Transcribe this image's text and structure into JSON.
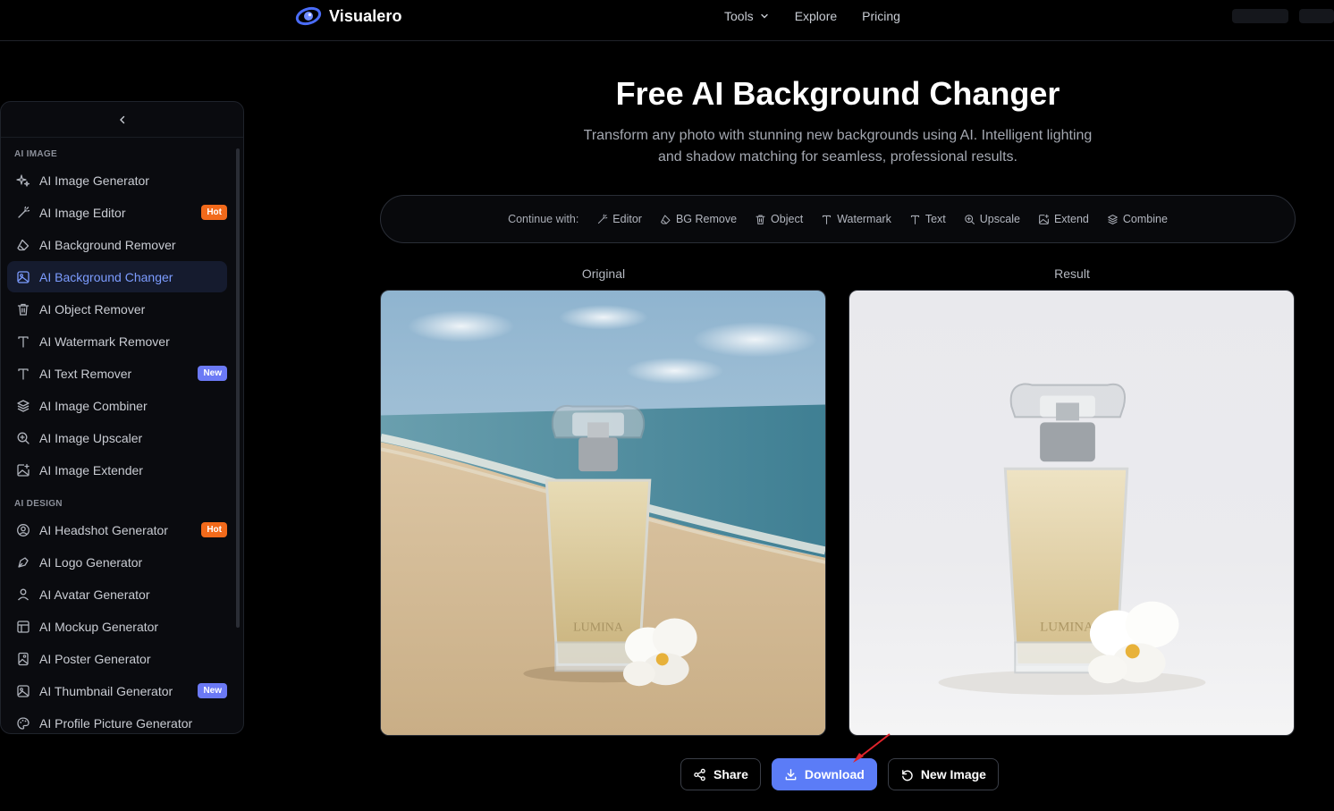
{
  "brand": {
    "name": "Visualero"
  },
  "nav": {
    "tools": "Tools",
    "explore": "Explore",
    "pricing": "Pricing"
  },
  "sidebar": {
    "sections": [
      {
        "label": "AI IMAGE",
        "items": [
          {
            "label": "AI Image Generator",
            "icon": "sparkles-icon"
          },
          {
            "label": "AI Image Editor",
            "icon": "magic-wand-icon",
            "badge": "Hot"
          },
          {
            "label": "AI Background Remover",
            "icon": "eraser-icon"
          },
          {
            "label": "AI Background Changer",
            "icon": "image-icon",
            "active": true
          },
          {
            "label": "AI Object Remover",
            "icon": "trash-icon"
          },
          {
            "label": "AI Watermark Remover",
            "icon": "text-t-icon"
          },
          {
            "label": "AI Text Remover",
            "icon": "text-t-icon",
            "badge": "New"
          },
          {
            "label": "AI Image Combiner",
            "icon": "layers-icon"
          },
          {
            "label": "AI Image Upscaler",
            "icon": "zoom-in-icon"
          },
          {
            "label": "AI Image Extender",
            "icon": "image-plus-icon"
          }
        ]
      },
      {
        "label": "AI DESIGN",
        "items": [
          {
            "label": "AI Headshot Generator",
            "icon": "user-circle-icon",
            "badge": "Hot"
          },
          {
            "label": "AI Logo Generator",
            "icon": "pen-tool-icon"
          },
          {
            "label": "AI Avatar Generator",
            "icon": "user-icon"
          },
          {
            "label": "AI Mockup Generator",
            "icon": "layout-icon"
          },
          {
            "label": "AI Poster Generator",
            "icon": "poster-icon"
          },
          {
            "label": "AI Thumbnail Generator",
            "icon": "image-icon",
            "badge": "New"
          },
          {
            "label": "AI Profile Picture Generator",
            "icon": "palette-icon"
          }
        ]
      }
    ]
  },
  "main": {
    "title": "Free AI Background Changer",
    "subtitle": "Transform any photo with stunning new backgrounds using AI. Intelligent lighting and shadow matching for seamless, professional results.",
    "continue_label": "Continue with:",
    "continue_items": [
      {
        "label": "Editor",
        "icon": "magic-wand-icon"
      },
      {
        "label": "BG Remove",
        "icon": "eraser-icon"
      },
      {
        "label": "Object",
        "icon": "trash-icon"
      },
      {
        "label": "Watermark",
        "icon": "text-t-icon"
      },
      {
        "label": "Text",
        "icon": "text-t-icon"
      },
      {
        "label": "Upscale",
        "icon": "zoom-in-icon"
      },
      {
        "label": "Extend",
        "icon": "image-plus-icon"
      },
      {
        "label": "Combine",
        "icon": "layers-icon"
      }
    ],
    "original_label": "Original",
    "result_label": "Result",
    "bottle_text": "LUMINA"
  },
  "actions": {
    "share": "Share",
    "download": "Download",
    "new_image": "New Image"
  },
  "colors": {
    "accent": "#5b7cf7",
    "active_text": "#7c9cff",
    "hot": "#f26a1b",
    "new": "#6b79f5"
  }
}
